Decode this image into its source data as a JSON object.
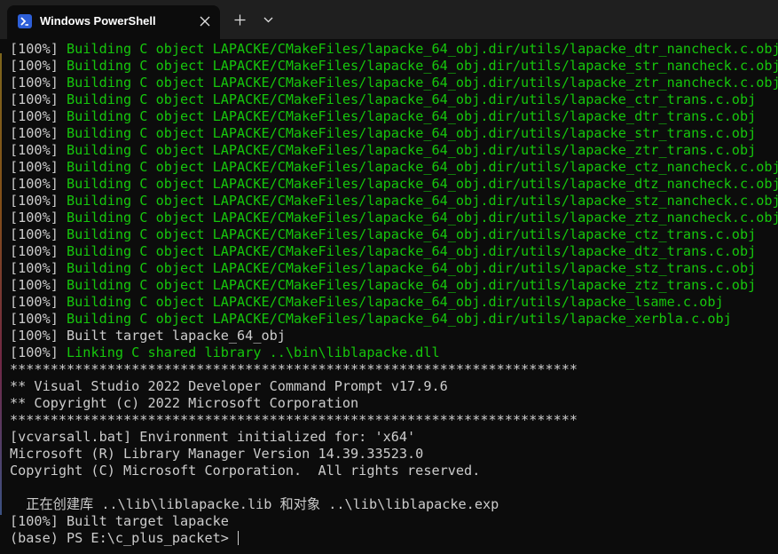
{
  "tab": {
    "title": "Windows PowerShell",
    "icon": "powershell-icon",
    "close_icon": "close-icon",
    "new_tab_icon": "plus-icon",
    "dropdown_icon": "chevron-down-icon"
  },
  "colors": {
    "background": "#0c0c0c",
    "titlebar": "#1f1f1f",
    "text": "#cccccc",
    "green": "#16c60c"
  },
  "lines": [
    {
      "prefix": "[100%] ",
      "text": "Building C object LAPACKE/CMakeFiles/lapacke_64_obj.dir/utils/lapacke_dtr_nancheck.c.obj",
      "color": "green"
    },
    {
      "prefix": "[100%] ",
      "text": "Building C object LAPACKE/CMakeFiles/lapacke_64_obj.dir/utils/lapacke_str_nancheck.c.obj",
      "color": "green"
    },
    {
      "prefix": "[100%] ",
      "text": "Building C object LAPACKE/CMakeFiles/lapacke_64_obj.dir/utils/lapacke_ztr_nancheck.c.obj",
      "color": "green"
    },
    {
      "prefix": "[100%] ",
      "text": "Building C object LAPACKE/CMakeFiles/lapacke_64_obj.dir/utils/lapacke_ctr_trans.c.obj",
      "color": "green"
    },
    {
      "prefix": "[100%] ",
      "text": "Building C object LAPACKE/CMakeFiles/lapacke_64_obj.dir/utils/lapacke_dtr_trans.c.obj",
      "color": "green"
    },
    {
      "prefix": "[100%] ",
      "text": "Building C object LAPACKE/CMakeFiles/lapacke_64_obj.dir/utils/lapacke_str_trans.c.obj",
      "color": "green"
    },
    {
      "prefix": "[100%] ",
      "text": "Building C object LAPACKE/CMakeFiles/lapacke_64_obj.dir/utils/lapacke_ztr_trans.c.obj",
      "color": "green"
    },
    {
      "prefix": "[100%] ",
      "text": "Building C object LAPACKE/CMakeFiles/lapacke_64_obj.dir/utils/lapacke_ctz_nancheck.c.obj",
      "color": "green"
    },
    {
      "prefix": "[100%] ",
      "text": "Building C object LAPACKE/CMakeFiles/lapacke_64_obj.dir/utils/lapacke_dtz_nancheck.c.obj",
      "color": "green"
    },
    {
      "prefix": "[100%] ",
      "text": "Building C object LAPACKE/CMakeFiles/lapacke_64_obj.dir/utils/lapacke_stz_nancheck.c.obj",
      "color": "green"
    },
    {
      "prefix": "[100%] ",
      "text": "Building C object LAPACKE/CMakeFiles/lapacke_64_obj.dir/utils/lapacke_ztz_nancheck.c.obj",
      "color": "green"
    },
    {
      "prefix": "[100%] ",
      "text": "Building C object LAPACKE/CMakeFiles/lapacke_64_obj.dir/utils/lapacke_ctz_trans.c.obj",
      "color": "green"
    },
    {
      "prefix": "[100%] ",
      "text": "Building C object LAPACKE/CMakeFiles/lapacke_64_obj.dir/utils/lapacke_dtz_trans.c.obj",
      "color": "green"
    },
    {
      "prefix": "[100%] ",
      "text": "Building C object LAPACKE/CMakeFiles/lapacke_64_obj.dir/utils/lapacke_stz_trans.c.obj",
      "color": "green"
    },
    {
      "prefix": "[100%] ",
      "text": "Building C object LAPACKE/CMakeFiles/lapacke_64_obj.dir/utils/lapacke_ztz_trans.c.obj",
      "color": "green"
    },
    {
      "prefix": "[100%] ",
      "text": "Building C object LAPACKE/CMakeFiles/lapacke_64_obj.dir/utils/lapacke_lsame.c.obj",
      "color": "green"
    },
    {
      "prefix": "[100%] ",
      "text": "Building C object LAPACKE/CMakeFiles/lapacke_64_obj.dir/utils/lapacke_xerbla.c.obj",
      "color": "green"
    },
    {
      "prefix": "[100%] ",
      "text": "Built target lapacke_64_obj",
      "color": "default"
    },
    {
      "prefix": "[100%] ",
      "text": "Linking C shared library ..\\bin\\liblapacke.dll",
      "color": "green"
    },
    {
      "prefix": "",
      "text": "**********************************************************************",
      "color": "default"
    },
    {
      "prefix": "",
      "text": "** Visual Studio 2022 Developer Command Prompt v17.9.6",
      "color": "default"
    },
    {
      "prefix": "",
      "text": "** Copyright (c) 2022 Microsoft Corporation",
      "color": "default"
    },
    {
      "prefix": "",
      "text": "**********************************************************************",
      "color": "default"
    },
    {
      "prefix": "",
      "text": "[vcvarsall.bat] Environment initialized for: 'x64'",
      "color": "default"
    },
    {
      "prefix": "",
      "text": "Microsoft (R) Library Manager Version 14.39.33523.0",
      "color": "default"
    },
    {
      "prefix": "",
      "text": "Copyright (C) Microsoft Corporation.  All rights reserved.",
      "color": "default"
    },
    {
      "prefix": "",
      "text": "",
      "color": "default"
    },
    {
      "prefix": "",
      "text": "  正在创建库 ..\\lib\\liblapacke.lib 和对象 ..\\lib\\liblapacke.exp",
      "color": "default"
    },
    {
      "prefix": "[100%] ",
      "text": "Built target lapacke",
      "color": "default"
    }
  ],
  "prompt": "(base) PS E:\\c_plus_packet> "
}
